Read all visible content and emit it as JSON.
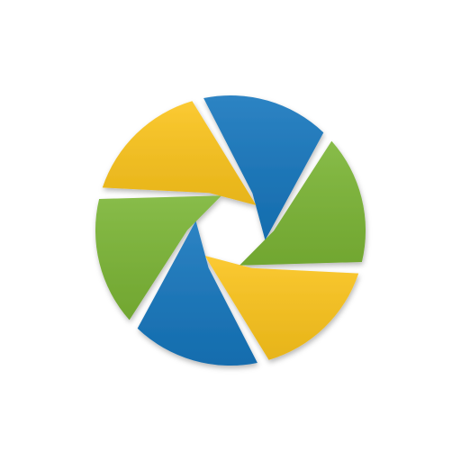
{
  "logo": {
    "name": "aperture-logo",
    "colors": {
      "blue": "#1676bd",
      "green": "#7bb535",
      "yellow": "#fbc41c",
      "background": "#ffffff"
    },
    "blades": [
      {
        "name": "blue-blade-top",
        "color": "blue"
      },
      {
        "name": "green-blade-right",
        "color": "green"
      },
      {
        "name": "yellow-blade-lower-right",
        "color": "yellow"
      },
      {
        "name": "blue-blade-bottom",
        "color": "blue"
      },
      {
        "name": "green-blade-left",
        "color": "green"
      },
      {
        "name": "yellow-blade-upper-left",
        "color": "yellow"
      }
    ]
  }
}
